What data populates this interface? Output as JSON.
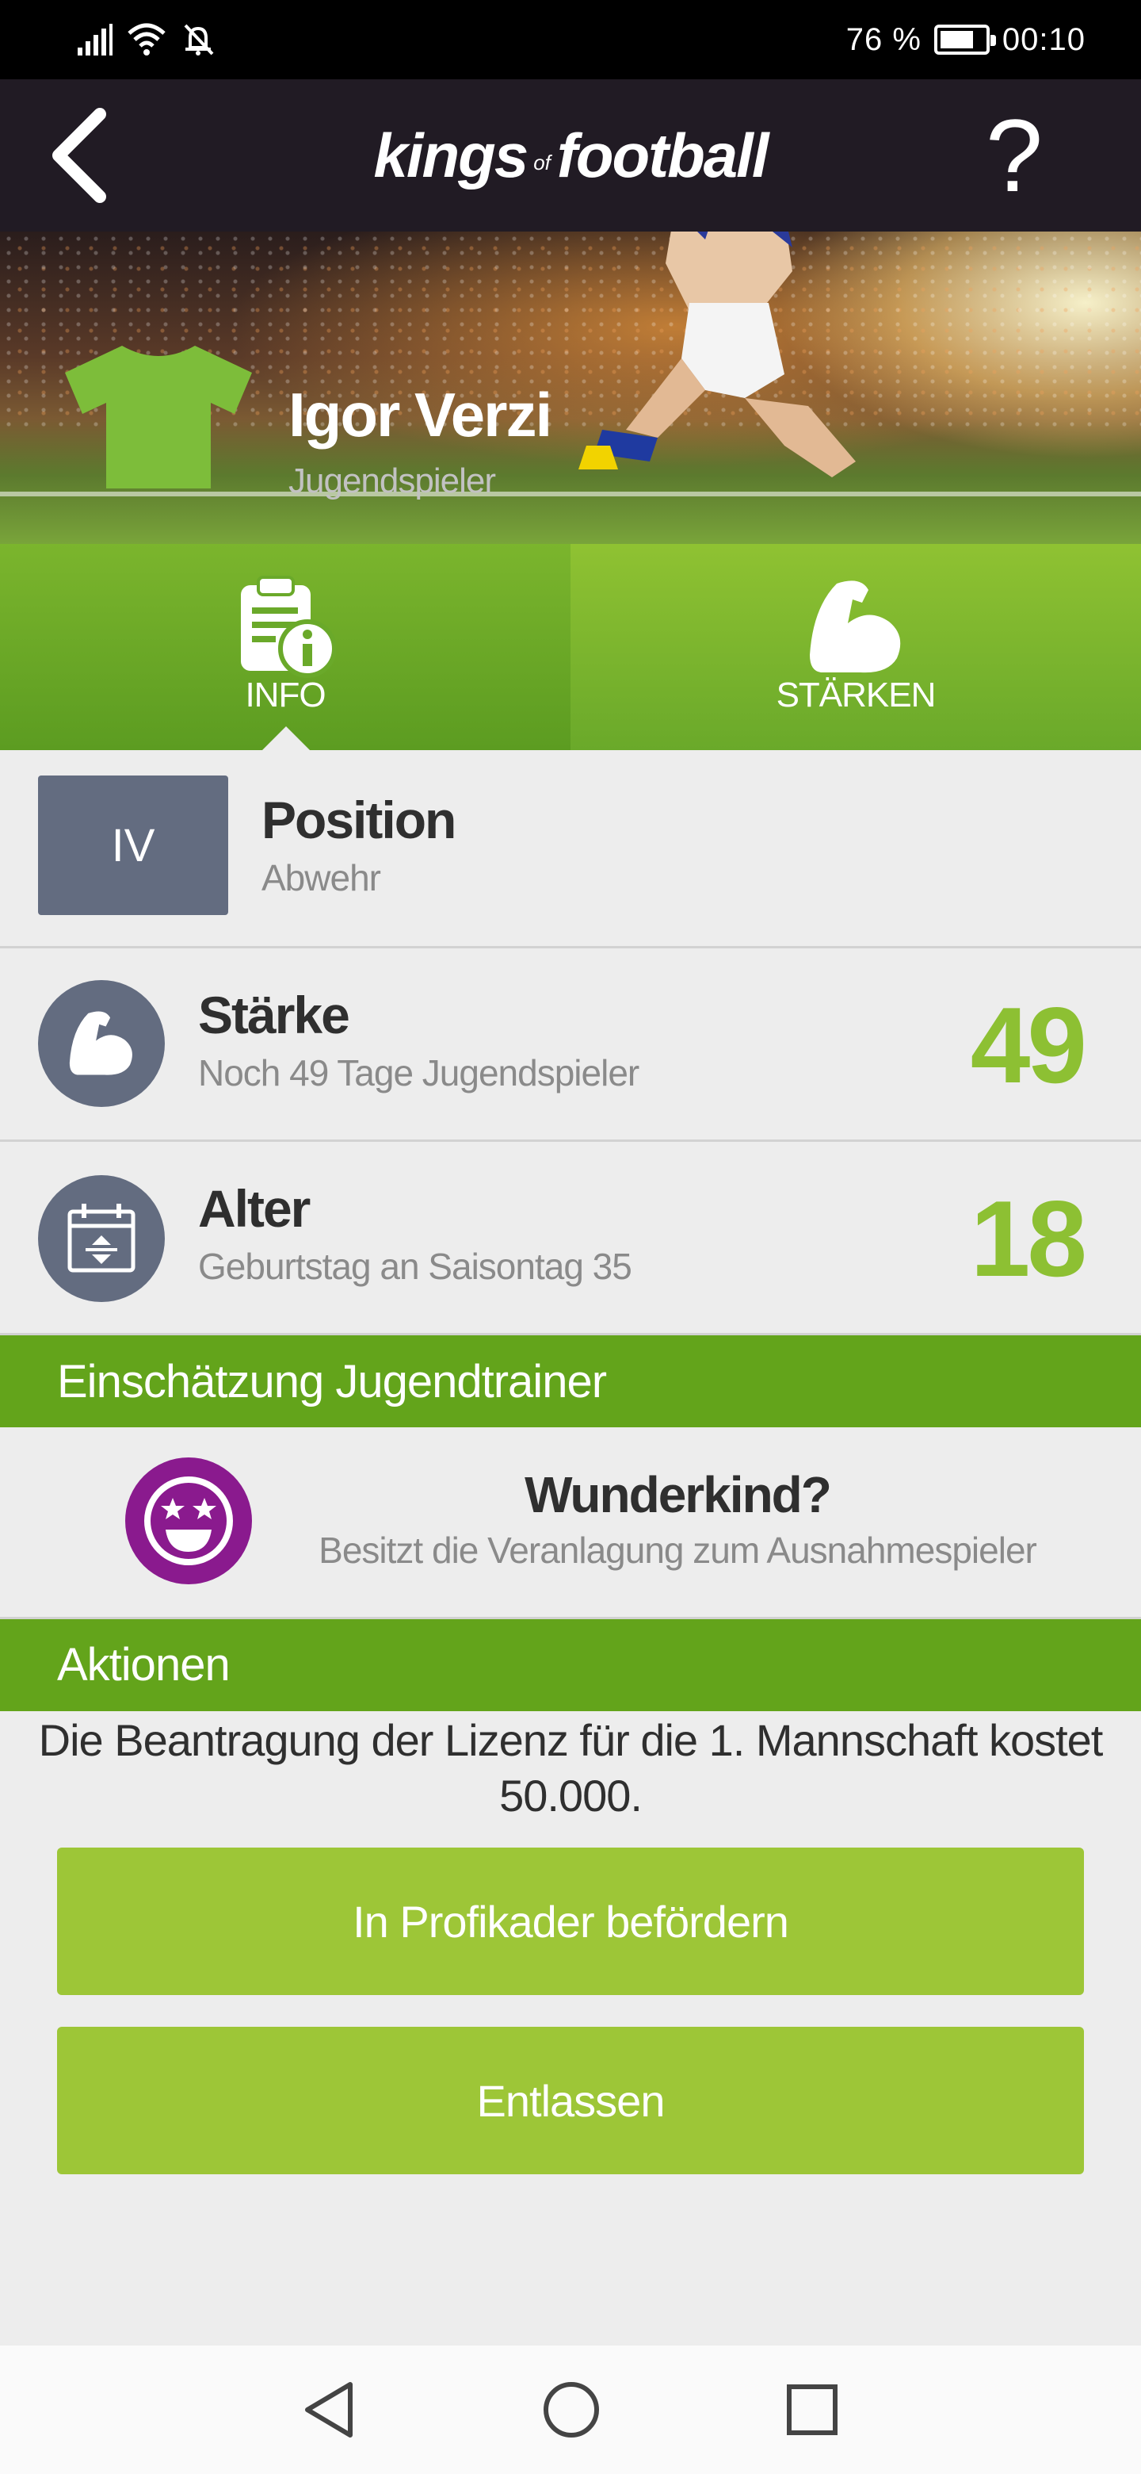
{
  "status_bar": {
    "battery_percent": "76 %",
    "battery_level": 0.76,
    "time": "00:10",
    "icons": [
      "signal-icon",
      "wifi-icon",
      "bell-off-icon",
      "battery-icon"
    ]
  },
  "app_bar": {
    "logo_part1": "kings",
    "logo_part2": "of",
    "logo_part3": "football",
    "help_label": "?"
  },
  "player": {
    "name": "Igor Verzi",
    "role": "Jugendspieler",
    "shirt_color": "#7dbd3a"
  },
  "tabs": [
    {
      "label": "INFO",
      "icon": "info-document-icon",
      "active": true
    },
    {
      "label": "STÄRKEN",
      "icon": "flexed-bicep-icon",
      "active": false
    }
  ],
  "position": {
    "code": "IV",
    "title": "Position",
    "subtitle": "Abwehr"
  },
  "strength": {
    "title": "Stärke",
    "subtitle": "Noch 49 Tage Jugendspieler",
    "value": "49",
    "icon": "flexed-bicep-icon"
  },
  "age": {
    "title": "Alter",
    "subtitle": "Geburtstag an Saisontag 35",
    "value": "18",
    "icon": "calendar-icon"
  },
  "assessment": {
    "header": "Einschätzung Jugendtrainer",
    "title": "Wunderkind?",
    "subtitle": "Besitzt die Veranlagung zum Ausnahmespieler",
    "icon": "star-eyes-smiley-icon"
  },
  "actions": {
    "header": "Aktionen",
    "license_line1": "Die Beantragung der Lizenz für die 1. Mannschaft kostet",
    "license_line2": "50.000.",
    "promote_label": "In Profikader befördern",
    "dismiss_label": "Entlassen"
  },
  "colors": {
    "accent_green": "#8dc033",
    "header_green": "#63a41b",
    "button_green": "#9dc637",
    "icon_slate": "#636c80",
    "appbar_dark": "#211b24",
    "smiley_purple": "#8a1a8e"
  }
}
